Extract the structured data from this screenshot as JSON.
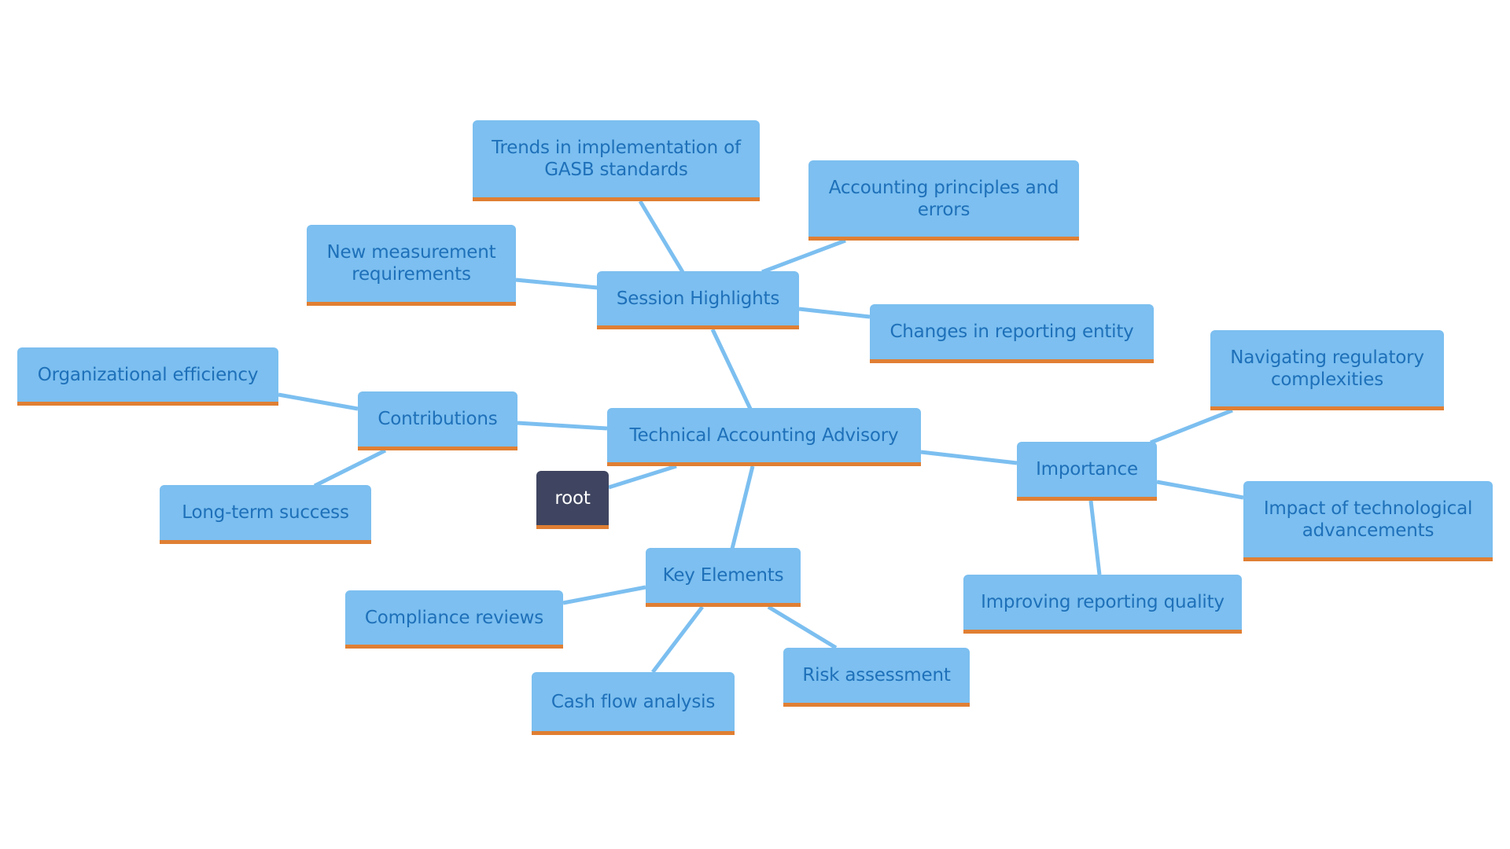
{
  "diagram": {
    "type": "mindmap",
    "colors": {
      "node_fill": "#7cbff0",
      "node_text": "#1e70b9",
      "node_underline": "#e07f33",
      "root_fill": "#3f4560",
      "root_text": "#ffffff",
      "edge": "#7cbff0"
    },
    "nodes": {
      "root": "root",
      "technical": "Technical Accounting Advisory",
      "session": "Session Highlights",
      "trends": "Trends in implementation of GASB standards",
      "accounting": "Accounting principles and errors",
      "new_measurement": "New measurement requirements",
      "changes": "Changes in reporting entity",
      "contributions": "Contributions",
      "org_efficiency": "Organizational efficiency",
      "long_term": "Long-term success",
      "importance": "Importance",
      "navigating": "Navigating regulatory complexities",
      "impact": "Impact of technological advancements",
      "improving": "Improving reporting quality",
      "key_elements": "Key Elements",
      "compliance": "Compliance reviews",
      "cash_flow": "Cash flow analysis",
      "risk": "Risk assessment"
    },
    "edges": [
      [
        "root",
        "technical"
      ],
      [
        "technical",
        "session"
      ],
      [
        "technical",
        "contributions"
      ],
      [
        "technical",
        "importance"
      ],
      [
        "technical",
        "key_elements"
      ],
      [
        "session",
        "trends"
      ],
      [
        "session",
        "accounting"
      ],
      [
        "session",
        "new_measurement"
      ],
      [
        "session",
        "changes"
      ],
      [
        "contributions",
        "org_efficiency"
      ],
      [
        "contributions",
        "long_term"
      ],
      [
        "importance",
        "navigating"
      ],
      [
        "importance",
        "impact"
      ],
      [
        "importance",
        "improving"
      ],
      [
        "key_elements",
        "compliance"
      ],
      [
        "key_elements",
        "cash_flow"
      ],
      [
        "key_elements",
        "risk"
      ]
    ]
  }
}
